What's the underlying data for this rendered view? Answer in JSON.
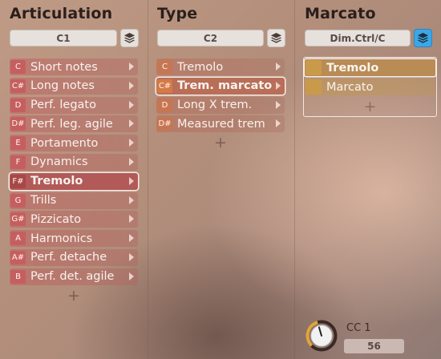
{
  "columns": {
    "articulation": {
      "title": "Articulation",
      "field": "C1"
    },
    "type": {
      "title": "Type",
      "field": "C2"
    },
    "marcato": {
      "title": "Marcato",
      "field": "Dim.Ctrl/C"
    }
  },
  "articulation_items": [
    {
      "key": "C",
      "label": "Short notes"
    },
    {
      "key": "C#",
      "label": "Long notes"
    },
    {
      "key": "D",
      "label": "Perf. legato"
    },
    {
      "key": "D#",
      "label": "Perf. leg. agile"
    },
    {
      "key": "E",
      "label": "Portamento"
    },
    {
      "key": "F",
      "label": "Dynamics"
    },
    {
      "key": "F#",
      "label": "Tremolo",
      "selected": true
    },
    {
      "key": "G",
      "label": "Trills"
    },
    {
      "key": "G#",
      "label": "Pizzicato"
    },
    {
      "key": "A",
      "label": "Harmonics"
    },
    {
      "key": "A#",
      "label": "Perf. detache"
    },
    {
      "key": "B",
      "label": "Perf. det. agile"
    }
  ],
  "type_items": [
    {
      "key": "C",
      "label": "Tremolo"
    },
    {
      "key": "C#",
      "label": "Trem. marcato",
      "selected": true
    },
    {
      "key": "D",
      "label": "Long X trem."
    },
    {
      "key": "D#",
      "label": "Measured trem"
    }
  ],
  "marcato_items": [
    {
      "label": "Tremolo",
      "selected": true
    },
    {
      "label": "Marcato"
    }
  ],
  "add_symbol": "+",
  "cc": {
    "label": "CC 1",
    "value": "56",
    "knob_level": 0.44
  },
  "colors": {
    "articulation_key": "#c55f5f",
    "type_key": "#c77653",
    "marcato_swatch": "#c99a4a",
    "active_layers_button": "#3aa7e8"
  },
  "icons": {
    "layers": "layers-icon",
    "chevron": "chevron-right-icon",
    "knob": "knob-icon"
  }
}
